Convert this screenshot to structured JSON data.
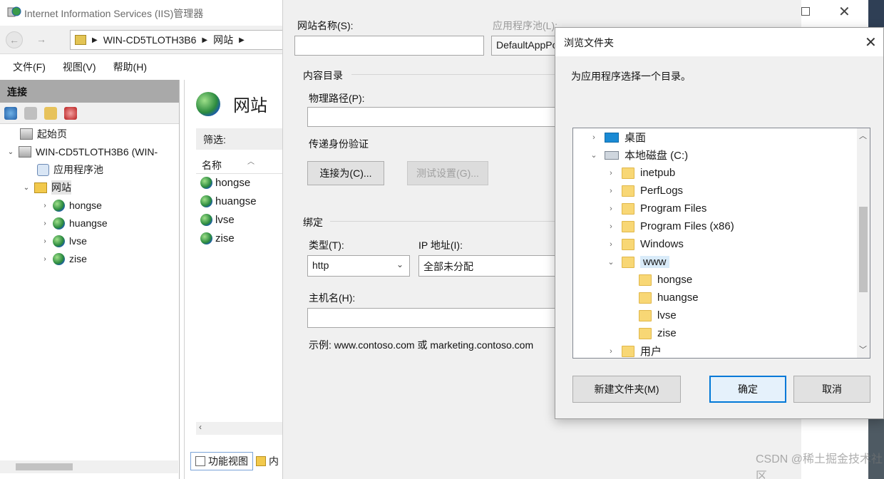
{
  "window": {
    "title": "Internet Information Services (IIS)管理器"
  },
  "address": {
    "segments": [
      "WIN-CD5TLOTH3B6",
      "网站"
    ]
  },
  "menu": {
    "file": "文件(F)",
    "view": "视图(V)",
    "help": "帮助(H)"
  },
  "connections": {
    "header": "连接",
    "tree": {
      "start_page": "起始页",
      "server": "WIN-CD5TLOTH3B6 (WIN-",
      "app_pools": "应用程序池",
      "sites": "网站",
      "site_items": [
        "hongse",
        "huangse",
        "lvse",
        "zise"
      ]
    }
  },
  "content": {
    "title": "网站",
    "filter_label": "筛选:",
    "column_name": "名称",
    "sites": [
      "hongse",
      "huangse",
      "lvse",
      "zise"
    ],
    "tab_feature_view": "功能视图",
    "tab_content_view": "内"
  },
  "add_site": {
    "site_name_label": "网站名称(S):",
    "site_name_value": "",
    "app_pool_label": "应用程序池(L):",
    "app_pool_value": "DefaultAppPool",
    "content_dir_group": "内容目录",
    "physical_path_label": "物理路径(P):",
    "physical_path_value": "",
    "pass_auth_label": "传递身份验证",
    "connect_as_button": "连接为(C)...",
    "test_settings_button": "测试设置(G)...",
    "binding_group": "绑定",
    "type_label": "类型(T):",
    "type_value": "http",
    "ip_label": "IP 地址(I):",
    "ip_value": "全部未分配",
    "hostname_label": "主机名(H):",
    "hostname_value": "",
    "example_text": "示例: www.contoso.com 或 marketing.contoso.com"
  },
  "browse": {
    "title": "浏览文件夹",
    "instruction": "为应用程序选择一个目录。",
    "tree": {
      "desktop": "桌面",
      "drive_c": "本地磁盘 (C:)",
      "c_children": [
        "inetpub",
        "PerfLogs",
        "Program Files",
        "Program Files (x86)",
        "Windows"
      ],
      "www": "www",
      "www_children": [
        "hongse",
        "huangse",
        "lvse",
        "zise"
      ],
      "users": "用户"
    },
    "new_folder_button": "新建文件夹(M)",
    "ok_button": "确定",
    "cancel_button": "取消"
  },
  "watermark": "CSDN @稀土掘金技术社区"
}
